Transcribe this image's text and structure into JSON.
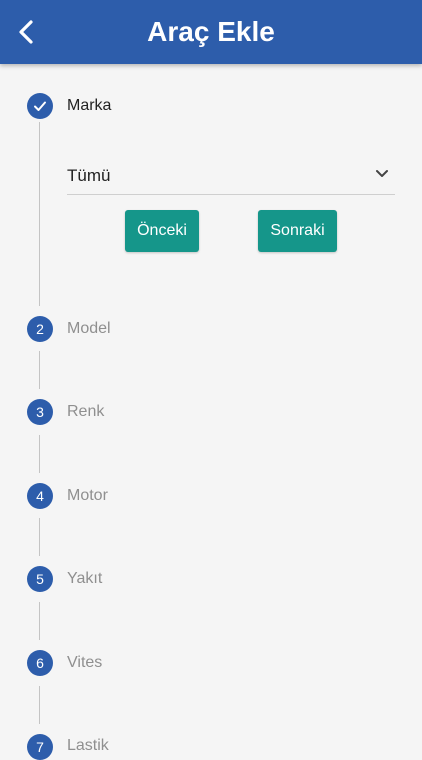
{
  "header": {
    "title": "Araç Ekle",
    "back_icon": "chevron-left-icon"
  },
  "colors": {
    "primary": "#2d5dab",
    "button": "#15968a",
    "inactive_text": "#8f8f8f"
  },
  "steps": [
    {
      "label": "Marka",
      "marker": "check",
      "state": "completed"
    },
    {
      "label": "Model",
      "marker": "2",
      "state": "pending"
    },
    {
      "label": "Renk",
      "marker": "3",
      "state": "pending"
    },
    {
      "label": "Motor",
      "marker": "4",
      "state": "pending"
    },
    {
      "label": "Yakıt",
      "marker": "5",
      "state": "pending"
    },
    {
      "label": "Vites",
      "marker": "6",
      "state": "pending"
    },
    {
      "label": "Lastik",
      "marker": "7",
      "state": "pending"
    }
  ],
  "active_step": {
    "dropdown_value": "Tümü",
    "prev_label": "Önceki",
    "next_label": "Sonraki"
  }
}
